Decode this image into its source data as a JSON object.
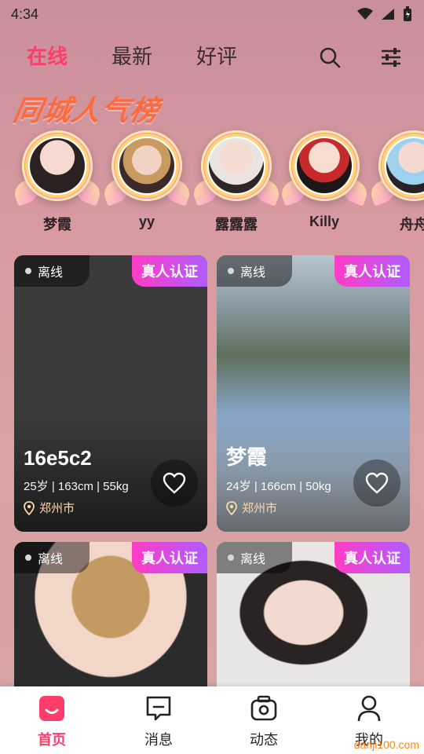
{
  "status": {
    "time": "4:34"
  },
  "tabs": [
    {
      "label": "在线",
      "active": true
    },
    {
      "label": "最新",
      "active": false
    },
    {
      "label": "好评",
      "active": false
    }
  ],
  "ranking_title": "同城人气榜",
  "ranking": [
    {
      "name": "梦霞"
    },
    {
      "name": "yy"
    },
    {
      "name": "露露露"
    },
    {
      "name": "Killy"
    },
    {
      "name": "舟舟"
    }
  ],
  "cards": [
    {
      "status": "离线",
      "badge": "真人认证",
      "nick": "16e5c2",
      "meta": "25岁 | 163cm | 55kg",
      "city": "郑州市"
    },
    {
      "status": "离线",
      "badge": "真人认证",
      "nick": "梦霞",
      "meta": "24岁 | 166cm | 50kg",
      "city": "郑州市"
    },
    {
      "status": "离线",
      "badge": "真人认证",
      "nick": "",
      "meta": "",
      "city": ""
    },
    {
      "status": "离线",
      "badge": "真人认证",
      "nick": "",
      "meta": "",
      "city": ""
    }
  ],
  "bottom_nav": [
    {
      "label": "首页",
      "icon": "home-icon",
      "active": true
    },
    {
      "label": "消息",
      "icon": "message-icon",
      "active": false
    },
    {
      "label": "动态",
      "icon": "camera-icon",
      "active": false
    },
    {
      "label": "我的",
      "icon": "profile-icon",
      "active": false
    }
  ],
  "watermark": "danji100.com",
  "colors": {
    "accent": "#ff3c6a",
    "badge_from": "#ff3cc5",
    "badge_to": "#b05cff"
  }
}
